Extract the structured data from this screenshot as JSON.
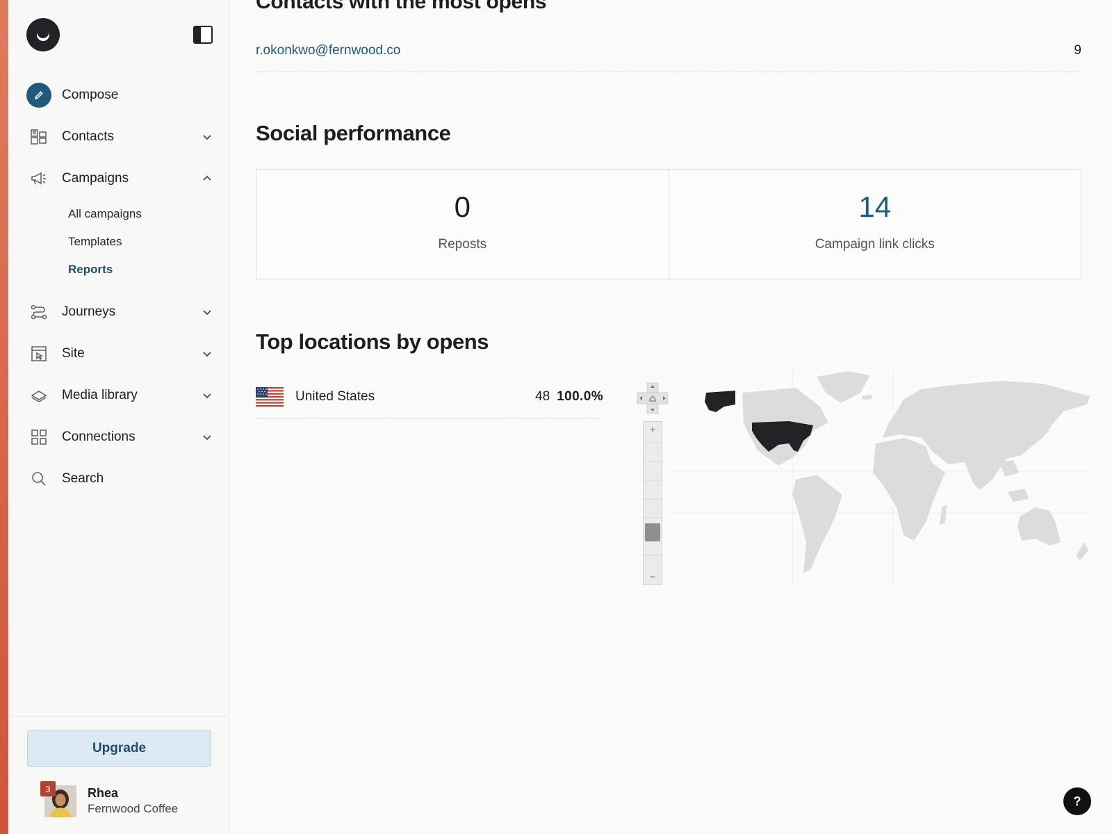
{
  "sidebar": {
    "nav": {
      "compose": "Compose",
      "contacts": "Contacts",
      "campaigns": "Campaigns",
      "campaign_children": [
        "All campaigns",
        "Templates",
        "Reports"
      ],
      "active_child": "Reports",
      "journeys": "Journeys",
      "site": "Site",
      "media_library": "Media library",
      "connections": "Connections",
      "search": "Search"
    },
    "upgrade_label": "Upgrade",
    "user": {
      "name": "Rhea",
      "org": "Fernwood Coffee",
      "notification_count": "3"
    }
  },
  "main": {
    "top_contacts": {
      "heading": "Contacts with the most opens",
      "rows": [
        {
          "email": "r.okonkwo@fernwood.co",
          "count": "9"
        }
      ]
    },
    "social": {
      "heading": "Social performance",
      "reposts": {
        "value": "0",
        "label": "Reposts"
      },
      "link_clicks": {
        "value": "14",
        "label": "Campaign link clicks"
      }
    },
    "locations": {
      "heading": "Top locations by opens",
      "rows": [
        {
          "country": "United States",
          "count": "48",
          "percent": "100.0%"
        }
      ]
    },
    "map": {
      "zoom_in": "+",
      "zoom_out": "−",
      "highlight_color": "#1f2326",
      "land_color": "#dcdcda",
      "zoom_level_fraction": 0.35
    }
  },
  "help_label": "?",
  "colors": {
    "accent": "#1f5a7a",
    "brand_strip": "#d0533f",
    "badge": "#b8402e",
    "upgrade_bg": "#dbeaf3"
  }
}
